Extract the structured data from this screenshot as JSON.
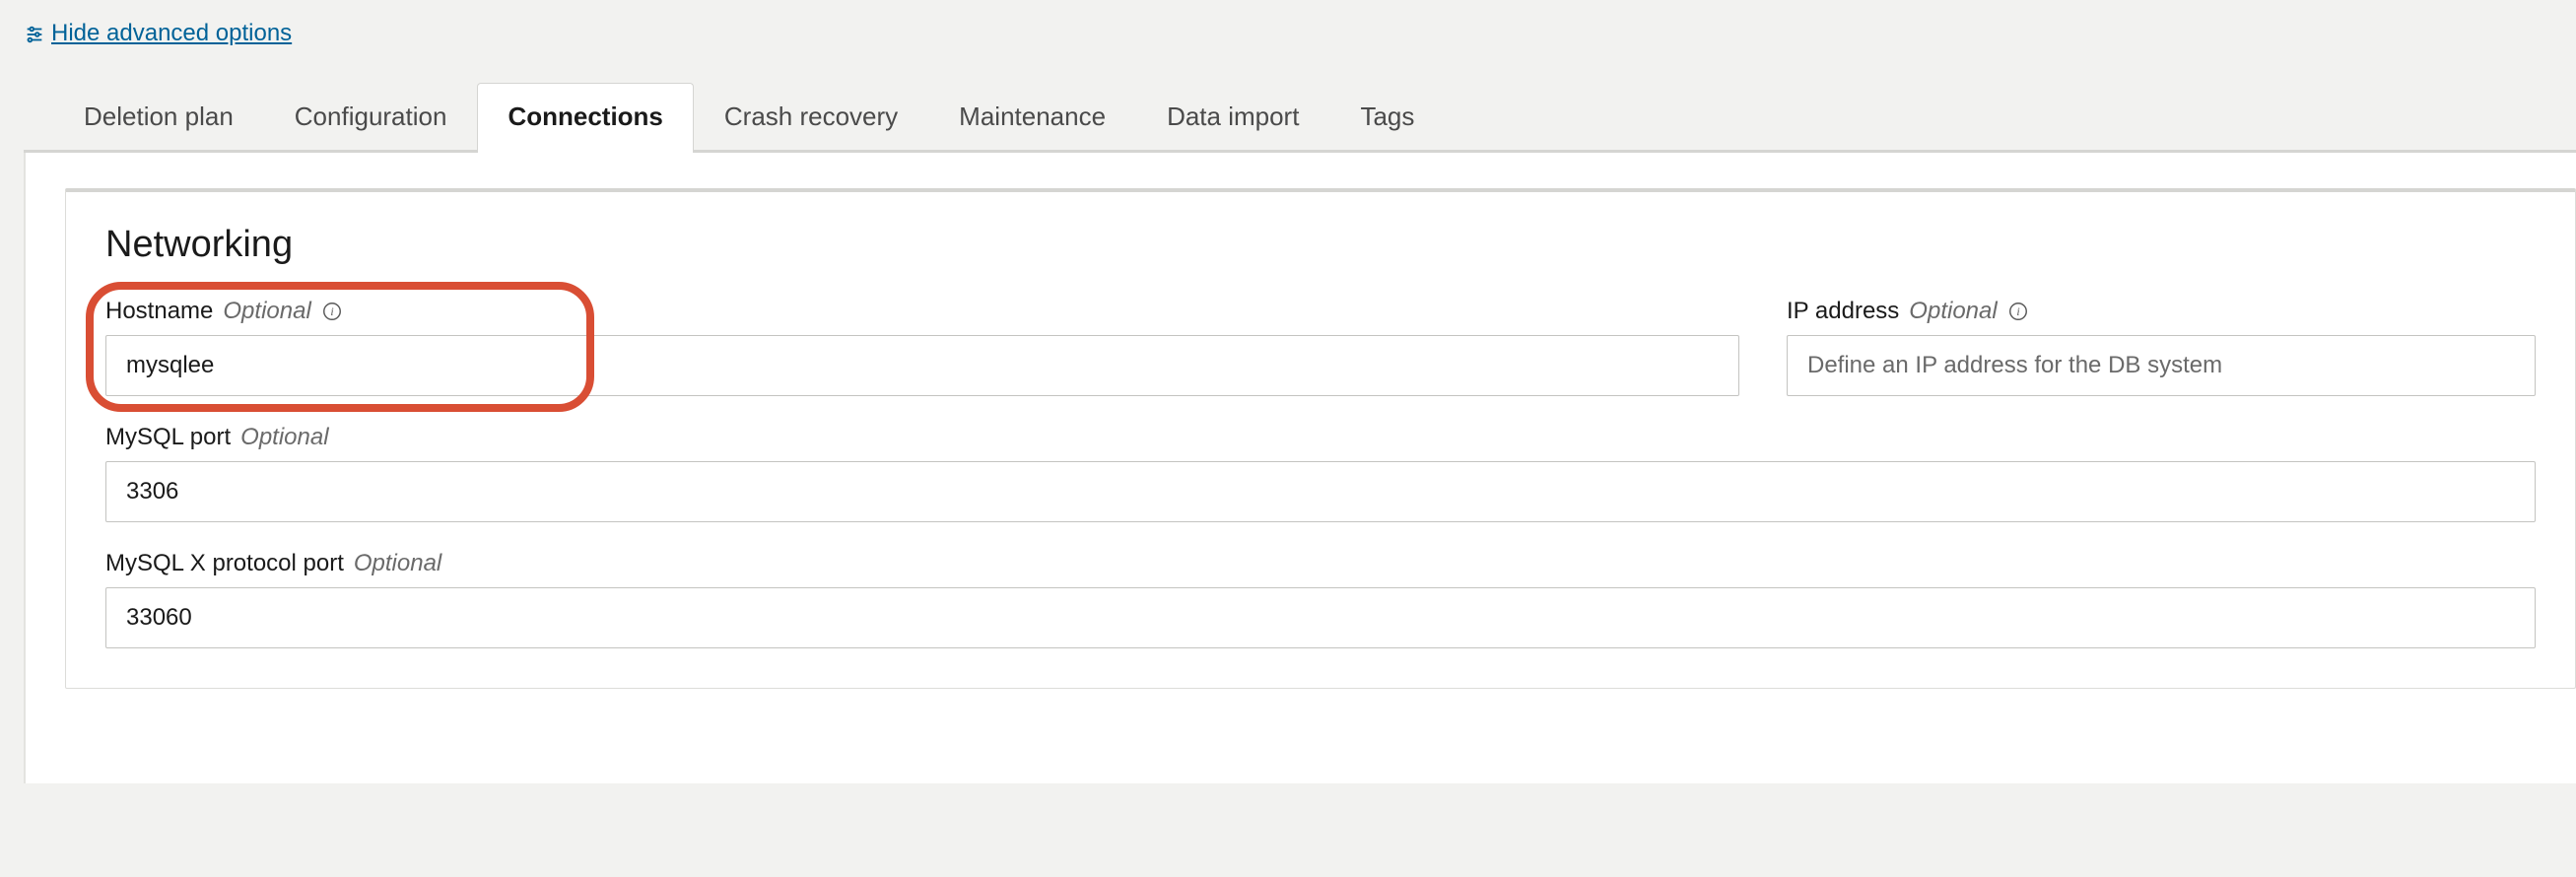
{
  "advanced": {
    "link_text": "Hide advanced options"
  },
  "tabs": [
    {
      "label": "Deletion plan"
    },
    {
      "label": "Configuration"
    },
    {
      "label": "Connections"
    },
    {
      "label": "Crash recovery"
    },
    {
      "label": "Maintenance"
    },
    {
      "label": "Data import"
    },
    {
      "label": "Tags"
    }
  ],
  "section": {
    "title": "Networking",
    "hostname": {
      "label": "Hostname",
      "optional": "Optional",
      "value": "mysqlee"
    },
    "ip": {
      "label": "IP address",
      "optional": "Optional",
      "placeholder": "Define an IP address for the DB system",
      "value": ""
    },
    "mysql_port": {
      "label": "MySQL port",
      "optional": "Optional",
      "value": "3306"
    },
    "mysql_x_port": {
      "label": "MySQL X protocol port",
      "optional": "Optional",
      "value": "33060"
    }
  }
}
